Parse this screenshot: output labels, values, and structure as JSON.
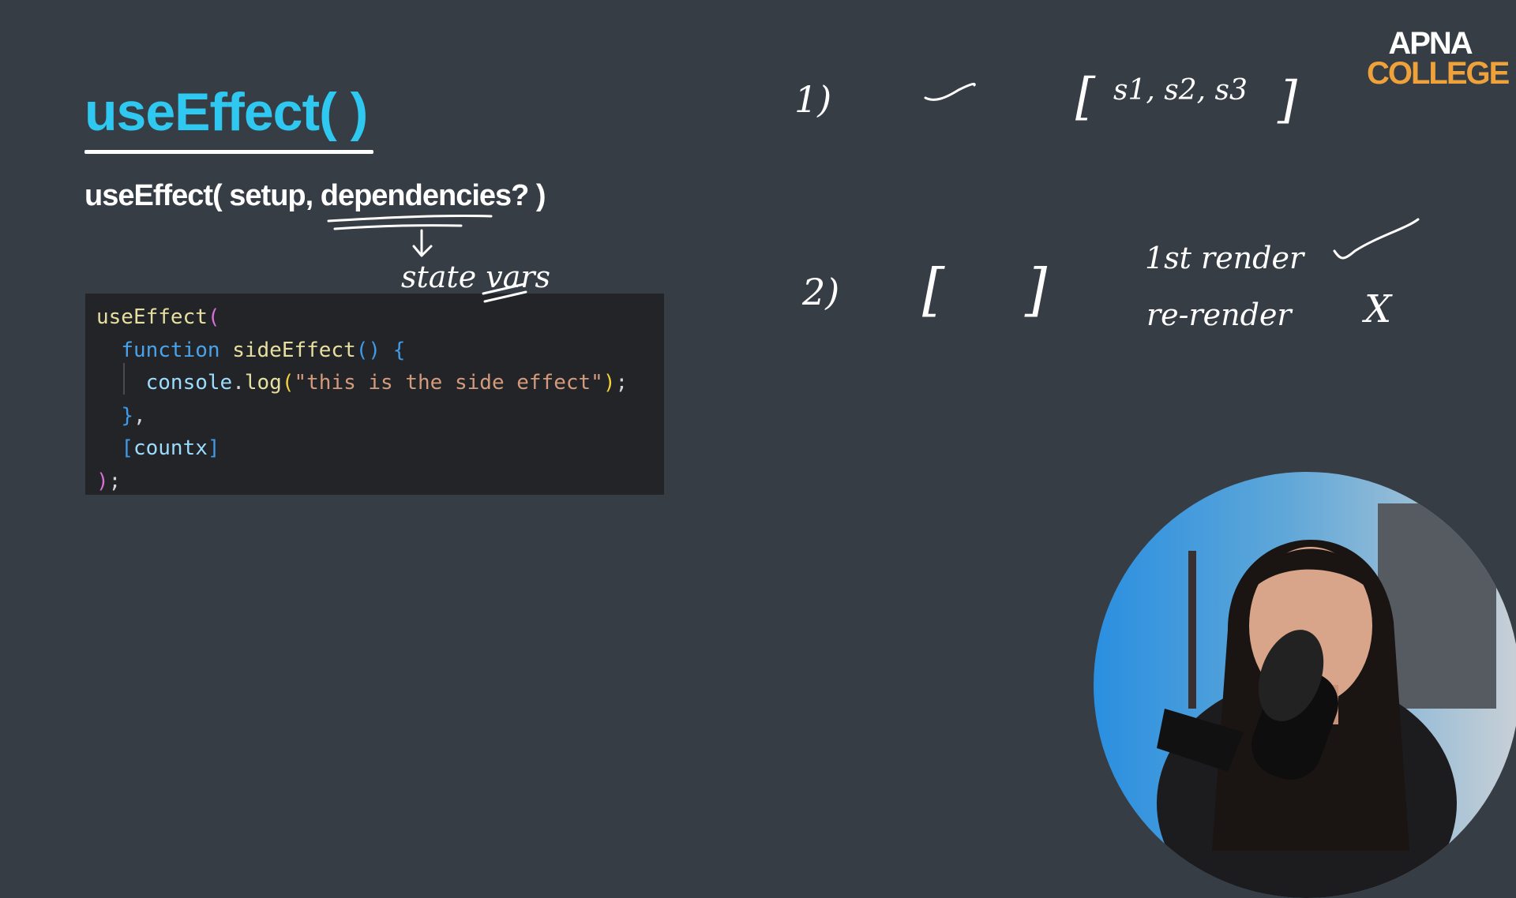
{
  "slide": {
    "title": "useEffect( )",
    "signature": {
      "prefix": "useEffect( setup, ",
      "highlight": "dependencies?",
      "suffix": " )"
    },
    "brand": {
      "line1": "APNA",
      "line2": "COLLEGE",
      "colors": {
        "line1": "#ffffff",
        "line2": "#f0a23a"
      }
    }
  },
  "code": {
    "lines": [
      {
        "tokens": [
          {
            "t": "useEffect",
            "c": "fn"
          },
          {
            "t": "(",
            "c": "p1"
          }
        ]
      },
      {
        "indent": "  ",
        "tokens": [
          {
            "t": "function ",
            "c": "kw"
          },
          {
            "t": "sideEffect",
            "c": "fn"
          },
          {
            "t": "() {",
            "c": "p2"
          }
        ]
      },
      {
        "indent": "    ",
        "guide": true,
        "tokens": [
          {
            "t": "console",
            "c": "var"
          },
          {
            "t": ".",
            "c": "plain"
          },
          {
            "t": "log",
            "c": "fn"
          },
          {
            "t": "(",
            "c": "p3"
          },
          {
            "t": "\"this is the side effect\"",
            "c": "str"
          },
          {
            "t": ")",
            "c": "p3"
          },
          {
            "t": ";",
            "c": "plain"
          }
        ]
      },
      {
        "indent": "  ",
        "tokens": [
          {
            "t": "}",
            "c": "p2"
          },
          {
            "t": ",",
            "c": "plain"
          }
        ]
      },
      {
        "indent": "  ",
        "tokens": [
          {
            "t": "[",
            "c": "p2"
          },
          {
            "t": "countx",
            "c": "var"
          },
          {
            "t": "]",
            "c": "p2"
          }
        ]
      },
      {
        "tokens": [
          {
            "t": ")",
            "c": "p1"
          },
          {
            "t": ";",
            "c": "plain"
          }
        ]
      }
    ]
  },
  "annotations": {
    "arrow_note": "state vars",
    "case1": {
      "number": "1)",
      "bracket_open": "[",
      "contents": "s1, s2, s3",
      "bracket_close": "]"
    },
    "case2": {
      "number": "2)",
      "bracket_open": "[",
      "bracket_close": "]",
      "line1": "1st render",
      "line2": "re-render",
      "line2_mark": "X"
    }
  },
  "colors": {
    "background": "#363d45",
    "title": "#2ec8f0",
    "code_background": "#232428"
  }
}
